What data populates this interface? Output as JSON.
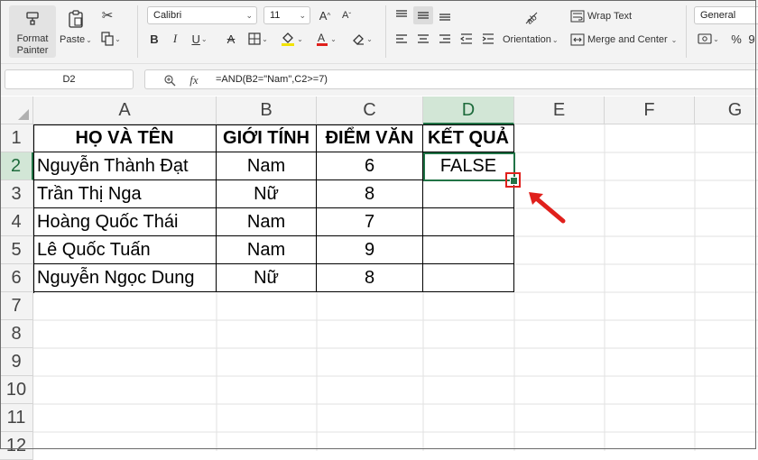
{
  "ribbon": {
    "clipboard": {
      "format_painter_label": "Format\nPainter",
      "paste_label": "Paste"
    },
    "font": {
      "name": "Calibri",
      "size": "11"
    },
    "alignment": {
      "orientation_label": "Orientation",
      "wrap_text_label": "Wrap Text",
      "merge_center_label": "Merge and Center"
    },
    "number": {
      "format": "General",
      "currency_symbol": "$",
      "percent_symbol": "%"
    }
  },
  "formula_bar": {
    "name_box": "D2",
    "fx_label": "fx",
    "formula": "=AND(B2=\"Nam\",C2>=7)"
  },
  "sheet": {
    "columns": [
      "A",
      "B",
      "C",
      "D",
      "E",
      "F",
      "G"
    ],
    "rows": [
      "1",
      "2",
      "3",
      "4",
      "5",
      "6",
      "7",
      "8",
      "9",
      "10",
      "11",
      "12"
    ],
    "headers": [
      "HỌ VÀ TÊN",
      "GIỚI TÍNH",
      "ĐIỂM VĂN",
      "KẾT QUẢ"
    ],
    "data": [
      [
        "Nguyễn Thành Đạt",
        "Nam",
        "6",
        "FALSE"
      ],
      [
        "Trần Thị Nga",
        "Nữ",
        "8",
        ""
      ],
      [
        "Hoàng Quốc Thái",
        "Nam",
        "7",
        ""
      ],
      [
        "Lê Quốc Tuấn",
        "Nam",
        "9",
        ""
      ],
      [
        "Nguyễn Ngọc Dung",
        "Nữ",
        "8",
        ""
      ]
    ],
    "selected_cell": "D2"
  },
  "colors": {
    "accent_green": "#217346",
    "annotation_red": "#e0201c",
    "ribbon_bg": "#f3f3f3"
  }
}
